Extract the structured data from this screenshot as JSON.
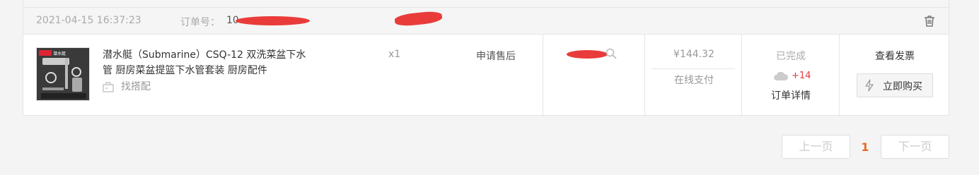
{
  "order": {
    "time": "2021-04-15 16:37:23",
    "order_no_label": "订单号：",
    "order_no_visible": "10"
  },
  "item": {
    "title": "潜水艇（Submarine）CSQ-12 双洗菜盆下水管 厨房菜盆提篮下水管套装 厨房配件",
    "match_label": "找搭配",
    "quantity": "x1",
    "aftersale_label": "申请售后",
    "thumb_brand": "潜水艇"
  },
  "payment": {
    "price": "¥144.32",
    "method": "在线支付"
  },
  "status": {
    "text": "已完成",
    "points": "+14",
    "detail_link": "订单详情"
  },
  "actions": {
    "invoice": "查看发票",
    "buy_again": "立即购买"
  },
  "pager": {
    "prev": "上一页",
    "current": "1",
    "next": "下一页"
  },
  "colors": {
    "accent_orange": "#e56b22",
    "points_red": "#e4393c",
    "redaction": "#e8312f"
  },
  "icons": [
    "trash-icon",
    "hanger-icon",
    "search-icon",
    "cloud-icon",
    "bolt-icon"
  ]
}
